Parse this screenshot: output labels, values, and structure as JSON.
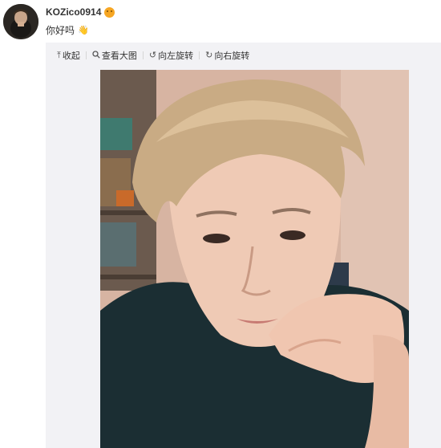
{
  "post": {
    "username": "KOZico0914",
    "badge_icon": "vip-emoji-icon",
    "text": "你好吗",
    "text_icon": "wave-hand-icon"
  },
  "toolbar": {
    "collapse": "收起",
    "view_large": "查看大图",
    "rotate_left": "向左旋转",
    "rotate_right": "向右旋转"
  },
  "photo": {
    "subject": "selfie-photo"
  },
  "colors": {
    "panel_bg": "#f2f2f5",
    "badge": "#f6a623"
  }
}
